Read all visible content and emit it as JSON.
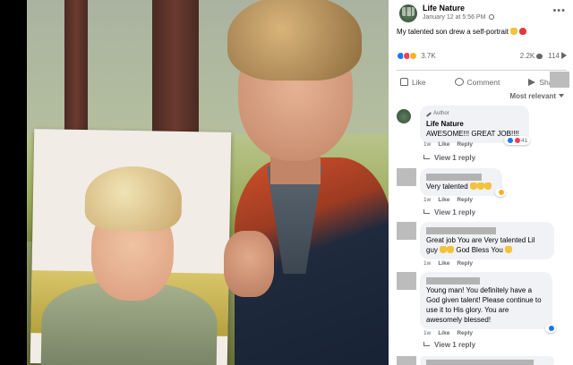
{
  "post": {
    "page_name": "Life Nature",
    "date": "January 12 at 5:56 PM",
    "more_label": "•••",
    "caption": "My talented son drew a self-portrait",
    "caption_emojis": [
      "praying-hands-emoji",
      "red-heart-emoji"
    ],
    "reaction_count": "3.7K",
    "comment_count": "2.2K",
    "share_count": "114",
    "reactions": [
      "like",
      "love",
      "wow"
    ]
  },
  "actions": {
    "like": "Like",
    "comment": "Comment",
    "share": "Share"
  },
  "sort_label": "Most relevant",
  "comments": [
    {
      "author_tag": "Author",
      "name": "Life Nature",
      "text": "AWESOME!!! GREAT JOB!!!!",
      "time": "1w",
      "like": "Like",
      "reply": "Reply",
      "reaction_count": "41",
      "view_replies": "View 1 reply"
    },
    {
      "text": "Very talented",
      "time": "1w",
      "like": "Like",
      "reply": "Reply",
      "view_replies": "View 1 reply"
    },
    {
      "text": "Great job You are Very talented Lil guy",
      "text_tail": "God Bless You",
      "time": "1w",
      "like": "Like",
      "reply": "Reply"
    },
    {
      "text": "Young man! You definitely have a God given talent! Please continue to use it to His glory. You are awesomely blessed!",
      "time": "1w",
      "like": "Like",
      "reply": "Reply",
      "view_replies": "View 1 reply"
    }
  ],
  "colors": {
    "like_blue": "#1877f2",
    "love_red": "#f33e58",
    "bubble_bg": "#f0f2f5",
    "meta_gray": "#65676b"
  }
}
